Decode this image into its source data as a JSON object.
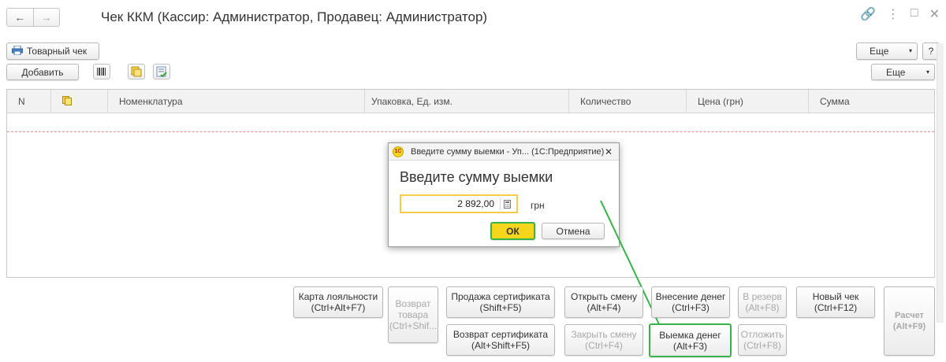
{
  "window": {
    "title": "Чек ККМ (Кассир: Администратор, Продавец: Администратор)",
    "nav_back": "←",
    "nav_forward": "→"
  },
  "toolbar": {
    "receipt_button": "Товарный чек",
    "more_top": "Еще",
    "help": "?"
  },
  "table_toolbar": {
    "add_button": "Добавить",
    "more": "Еще"
  },
  "table": {
    "columns": [
      "N",
      "",
      "Номенклатура",
      "Упаковка, Ед. изм.",
      "Количество",
      "Цена (грн)",
      "Сумма"
    ]
  },
  "dialog": {
    "logo": "1С",
    "window_title": "Введите сумму выемки - Уп...  (1С:Предприятие)",
    "close": "✕",
    "heading": "Введите сумму выемки",
    "amount_value": "2 892,00",
    "currency": "грн",
    "ok_label": "ОК",
    "cancel_label": "Отмена"
  },
  "actions": {
    "loyalty_card": [
      "Карта лояльности",
      "(Ctrl+Alt+F7)"
    ],
    "return_goods": [
      "Возврат",
      "товара",
      "(Ctrl+Shif..."
    ],
    "sell_certificate": [
      "Продажа сертификата",
      "(Shift+F5)"
    ],
    "return_certificate": [
      "Возврат сертификата",
      "(Alt+Shift+F5)"
    ],
    "open_shift": [
      "Открыть смену",
      "(Alt+F4)"
    ],
    "close_shift": [
      "Закрыть смену",
      "(Ctrl+F4)"
    ],
    "cash_in": [
      "Внесение денег",
      "(Ctrl+F3)"
    ],
    "cash_out": [
      "Выемка денег",
      "(Alt+F3)"
    ],
    "reserve": [
      "В резерв",
      "(Alt+F8)"
    ],
    "postpone": [
      "Отложить",
      "(Ctrl+F8)"
    ],
    "new_receipt": [
      "Новый чек",
      "(Ctrl+F12)"
    ],
    "payment": [
      "Расчет",
      "(Alt+F9)"
    ]
  },
  "colors": {
    "highlight": "#37b34a",
    "ok_fill": "#f5d61c",
    "field_border": "#f5cc4a"
  }
}
